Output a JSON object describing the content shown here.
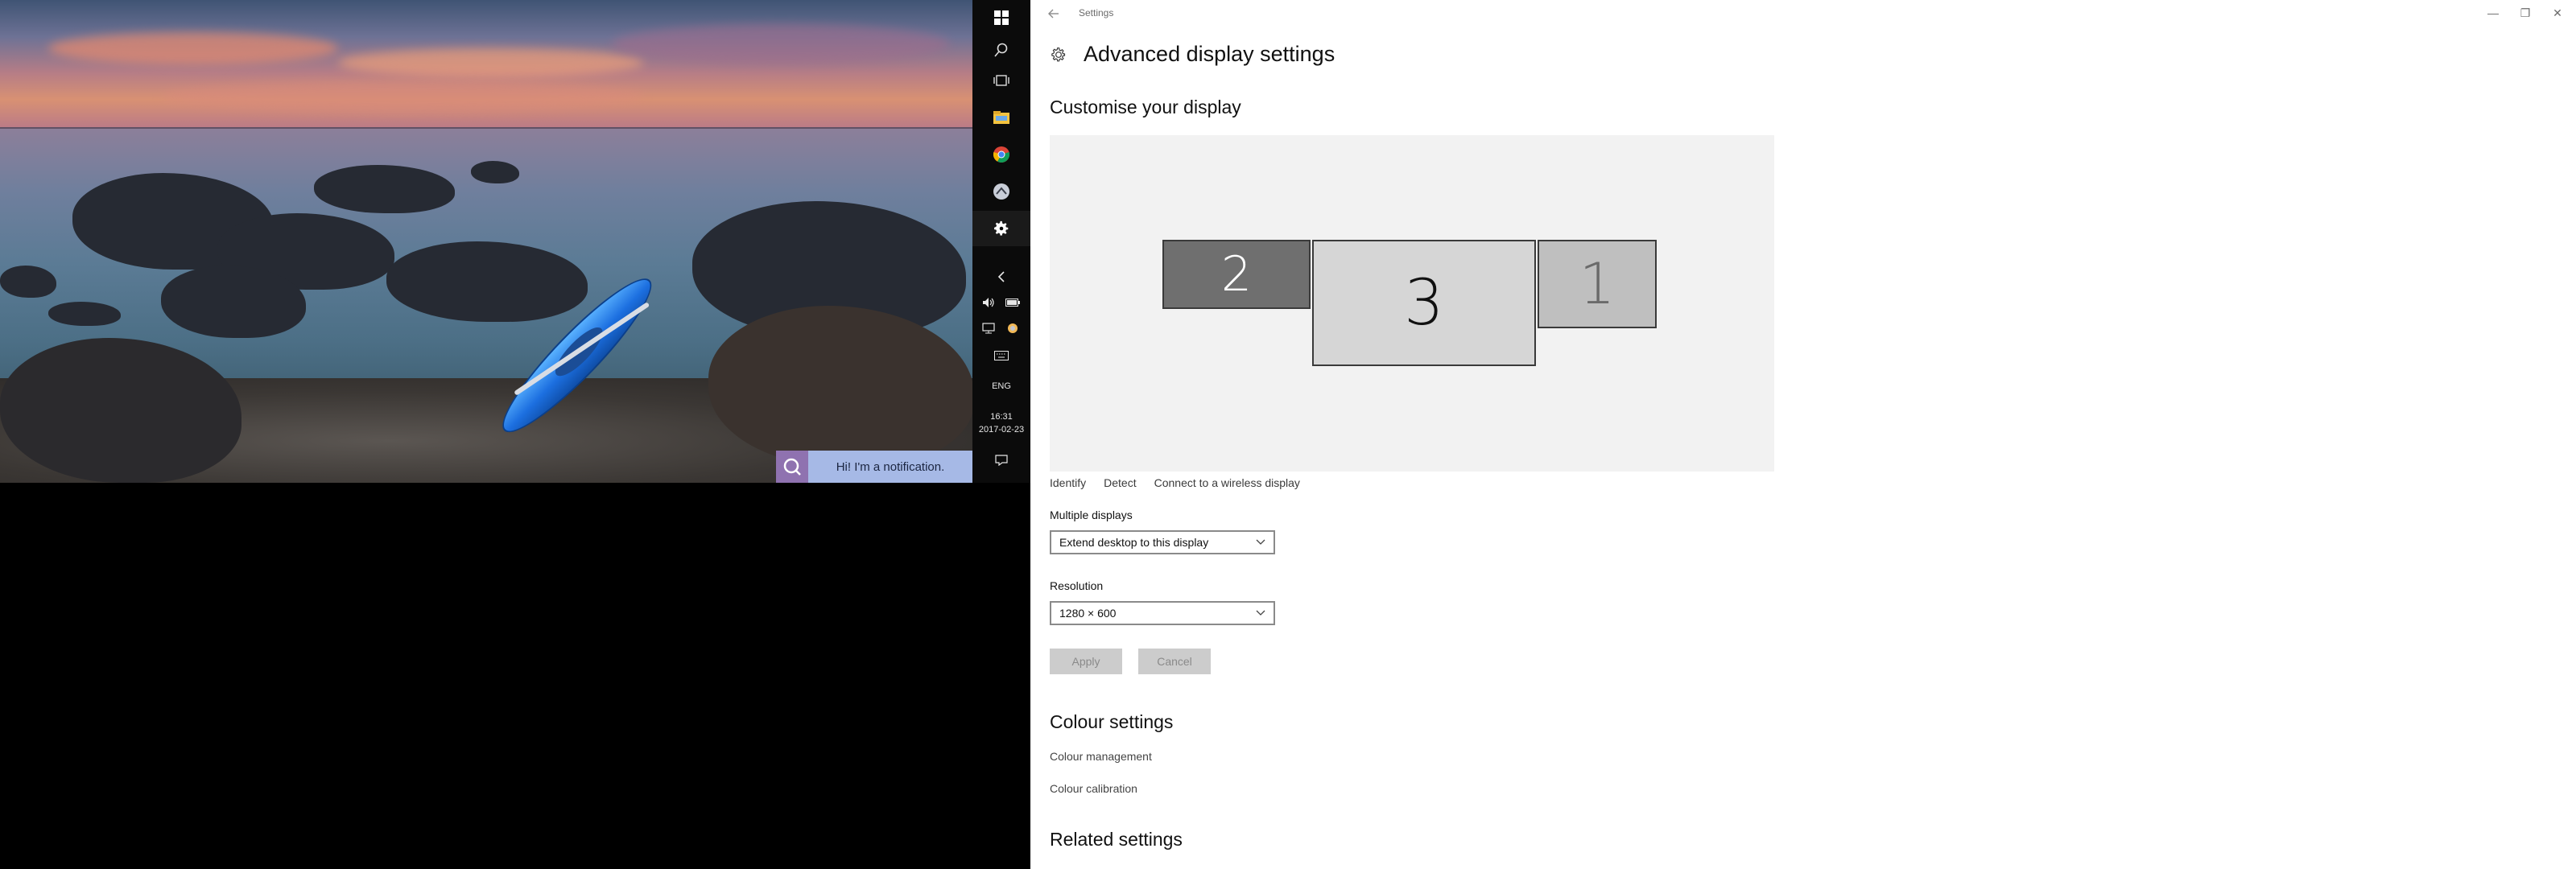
{
  "desktop": {
    "notification": {
      "icon": "q-app-icon",
      "text": "Hi! I'm a notification."
    }
  },
  "taskbar": {
    "items": [
      {
        "name": "start-icon"
      },
      {
        "name": "search-icon"
      },
      {
        "name": "task-view-icon"
      },
      {
        "name": "file-explorer-icon"
      },
      {
        "name": "chrome-icon"
      },
      {
        "name": "app-icon"
      },
      {
        "name": "settings-gear-icon"
      }
    ],
    "tray": {
      "language": "ENG",
      "time": "16:31",
      "date": "2017-02-23"
    }
  },
  "window": {
    "title": "Settings",
    "back_icon": "back-arrow-icon",
    "controls": {
      "minimize": "—",
      "maximize": "❐",
      "close": "✕"
    }
  },
  "page": {
    "title": "Advanced display settings",
    "customise_heading": "Customise your display",
    "monitors": {
      "left": "2",
      "center": "3",
      "right": "1"
    },
    "actions": {
      "identify": "Identify",
      "detect": "Detect",
      "wireless": "Connect to a wireless display"
    },
    "multiple_displays": {
      "label": "Multiple displays",
      "value": "Extend desktop to this display"
    },
    "resolution": {
      "label": "Resolution",
      "value": "1280 × 600"
    },
    "buttons": {
      "apply": "Apply",
      "cancel": "Cancel"
    },
    "colour_heading": "Colour settings",
    "colour_links": {
      "management": "Colour management",
      "calibration": "Colour calibration"
    },
    "related_heading": "Related settings"
  }
}
